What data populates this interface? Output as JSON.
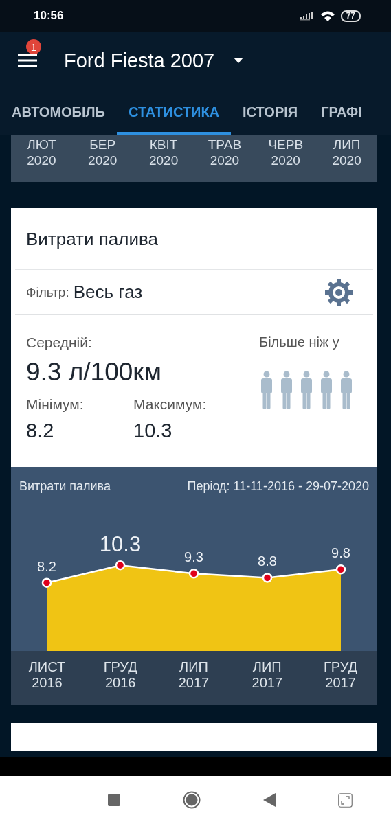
{
  "status_bar": {
    "time": "10:56",
    "battery": "77"
  },
  "app_bar": {
    "title": "Ford Fiesta 2007",
    "menu_badge": "1"
  },
  "tabs": [
    {
      "label": "АВТОМОБІЛЬ",
      "selected": false
    },
    {
      "label": "СТАТИСТИКА",
      "selected": true
    },
    {
      "label": "ІСТОРІЯ",
      "selected": false
    },
    {
      "label": "ГРАФІ",
      "selected": false
    }
  ],
  "months_strip": [
    {
      "month": "ЛЮТ",
      "year": "2020"
    },
    {
      "month": "БЕР",
      "year": "2020"
    },
    {
      "month": "КВІТ",
      "year": "2020"
    },
    {
      "month": "ТРАВ",
      "year": "2020"
    },
    {
      "month": "ЧЕРВ",
      "year": "2020"
    },
    {
      "month": "ЛИП",
      "year": "2020"
    }
  ],
  "fuel_card": {
    "title": "Витрати палива",
    "filter_label": "Фільтр:",
    "filter_value": "Весь газ",
    "average_label": "Середній:",
    "average_value": "9.3 л/100км",
    "min_label": "Мінімум:",
    "min_value": "8.2",
    "max_label": "Максимум:",
    "max_value": "10.3",
    "compare_label": "Більше ніж у",
    "period": "Період: 11-11-2016 - 29-07-2020",
    "chart_data": {
      "type": "area",
      "title": "Витрати палива",
      "categories": [
        "ЛИСТ 2016",
        "ГРУД 2016",
        "ЛИП 2017",
        "ЛИП 2017",
        "ГРУД 2017"
      ],
      "series": [
        {
          "color": "#f0c414",
          "values": [
            8.2,
            10.3,
            9.3,
            8.8,
            9.8
          ]
        }
      ],
      "data_labels": true
    }
  }
}
